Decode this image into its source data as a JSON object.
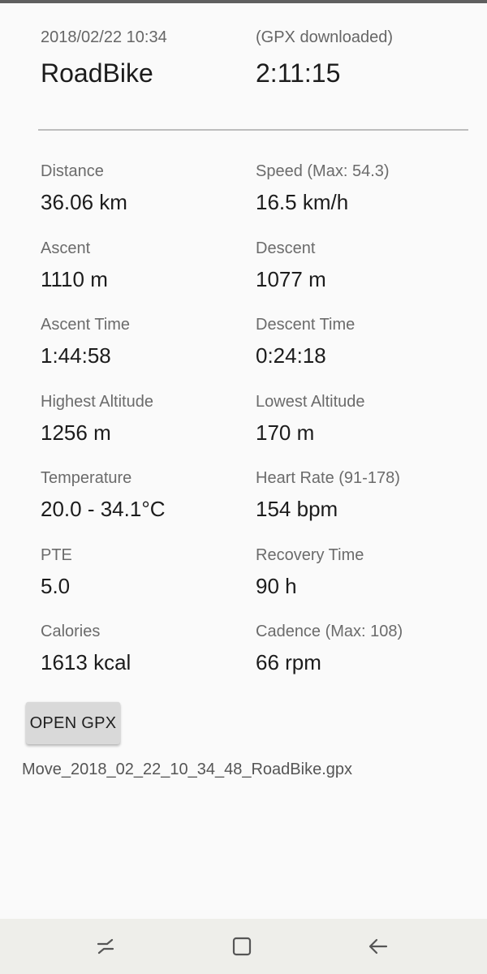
{
  "header": {
    "datetime": "2018/02/22 10:34",
    "activity": "RoadBike",
    "gpx_status": "(GPX downloaded)",
    "duration": "2:11:15"
  },
  "stats": [
    {
      "label": "Distance",
      "value": "36.06 km"
    },
    {
      "label": "Speed (Max: 54.3)",
      "value": "16.5 km/h"
    },
    {
      "label": "Ascent",
      "value": "1110 m"
    },
    {
      "label": "Descent",
      "value": "1077 m"
    },
    {
      "label": "Ascent Time",
      "value": "1:44:58"
    },
    {
      "label": "Descent Time",
      "value": "0:24:18"
    },
    {
      "label": "Highest Altitude",
      "value": "1256 m"
    },
    {
      "label": "Lowest Altitude",
      "value": "170 m"
    },
    {
      "label": "Temperature",
      "value": "20.0 - 34.1°C"
    },
    {
      "label": "Heart Rate (91-178)",
      "value": "154 bpm"
    },
    {
      "label": "PTE",
      "value": "5.0"
    },
    {
      "label": "Recovery Time",
      "value": "90 h"
    },
    {
      "label": "Calories",
      "value": "1613 kcal"
    },
    {
      "label": "Cadence (Max: 108)",
      "value": "66 rpm"
    }
  ],
  "actions": {
    "open_gpx_label": "OPEN GPX"
  },
  "file": {
    "name": "Move_2018_02_22_10_34_48_RoadBike.gpx"
  },
  "navbar": {
    "icons": [
      "recent-apps-icon",
      "home-icon",
      "back-icon"
    ]
  }
}
